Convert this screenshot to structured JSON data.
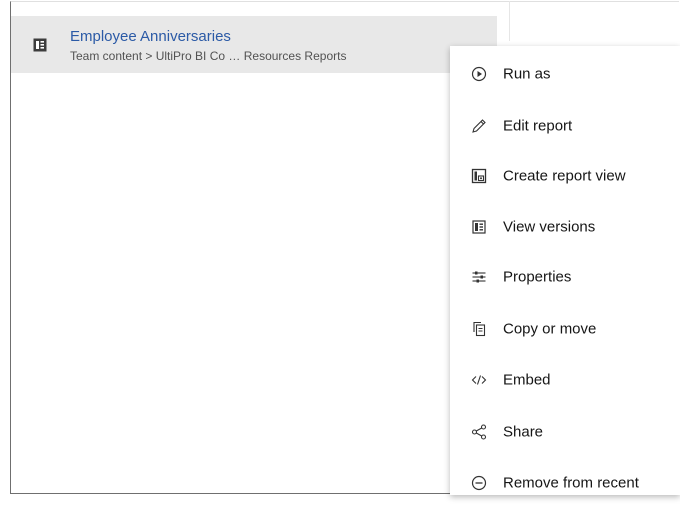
{
  "recent_item": {
    "title": "Employee Anniversaries",
    "path": "Team content > UltiPro BI Co … Resources Reports",
    "icon": "report-icon"
  },
  "menu": {
    "items": [
      {
        "label": "Run as",
        "icon": "play-circle-icon"
      },
      {
        "label": "Edit report",
        "icon": "pencil-icon"
      },
      {
        "label": "Create report view",
        "icon": "report-view-icon"
      },
      {
        "label": "View versions",
        "icon": "versions-icon"
      },
      {
        "label": "Properties",
        "icon": "sliders-icon"
      },
      {
        "label": "Copy or move",
        "icon": "copy-icon"
      },
      {
        "label": "Embed",
        "icon": "code-icon"
      },
      {
        "label": "Share",
        "icon": "share-icon"
      },
      {
        "label": "Remove from recent",
        "icon": "minus-circle-icon"
      }
    ]
  },
  "colors": {
    "title_link": "#2b5aa6",
    "row_highlight": "#e8e8e8"
  }
}
